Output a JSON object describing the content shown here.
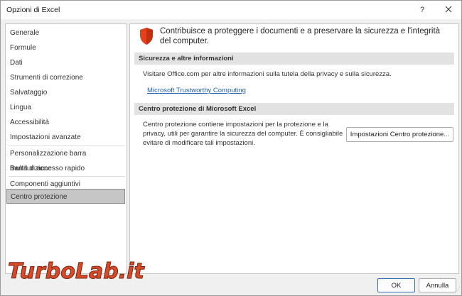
{
  "window": {
    "title": "Opzioni di Excel",
    "help_glyph": "?",
    "close_glyph": "✕"
  },
  "sidebar": {
    "items": [
      {
        "label": "Generale"
      },
      {
        "label": "Formule"
      },
      {
        "label": "Dati"
      },
      {
        "label": "Strumenti di correzione"
      },
      {
        "label": "Salvataggio"
      },
      {
        "label": "Lingua"
      },
      {
        "label": "Accessibilità"
      },
      {
        "label": "Impostazioni avanzate"
      },
      {
        "label": "Personalizzazione barra multifunzione"
      },
      {
        "label": "Barra di accesso rapido"
      },
      {
        "label": "Componenti aggiuntivi"
      },
      {
        "label": "Centro protezione",
        "selected": true
      }
    ]
  },
  "main": {
    "heading": "Contribuisce a proteggere i documenti e a preservare la sicurezza e l'integrità del computer.",
    "icon": "shield-icon",
    "accent_color": "#e8401c",
    "section1": {
      "title": "Sicurezza e altre informazioni",
      "text": "Visitare Office.com per altre informazioni sulla tutela della privacy e sulla sicurezza.",
      "link": "Microsoft Trustworthy Computing"
    },
    "section2": {
      "title": "Centro protezione di Microsoft Excel",
      "text": "Centro protezione contiene impostazioni per la protezione e la privacy, utili per garantire la sicurezza del computer. È consigliabile evitare di modificare tali impostazioni.",
      "button": "Impostazioni Centro protezione..."
    }
  },
  "footer": {
    "ok_label": "OK",
    "cancel_label": "Annulla"
  },
  "watermark": {
    "text": "TurboLab.it"
  }
}
